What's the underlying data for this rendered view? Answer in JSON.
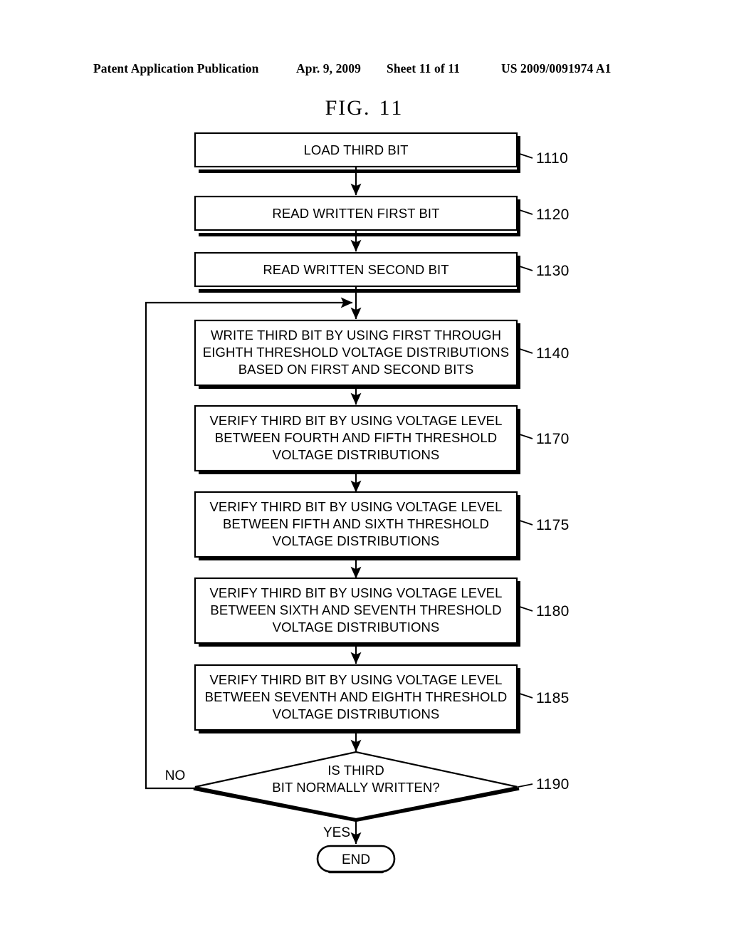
{
  "header": {
    "publication": "Patent Application Publication",
    "date": "Apr. 9, 2009",
    "sheet": "Sheet 11 of 11",
    "serial": "US 2009/0091974 A1"
  },
  "figure": {
    "label": "FIG.",
    "number": "11"
  },
  "flowchart": {
    "nodes": [
      {
        "id": "1110",
        "ref": "1110",
        "shape": "process",
        "lines": [
          "LOAD THIRD BIT"
        ]
      },
      {
        "id": "1120",
        "ref": "1120",
        "shape": "process",
        "lines": [
          "READ WRITTEN FIRST BIT"
        ]
      },
      {
        "id": "1130",
        "ref": "1130",
        "shape": "process",
        "lines": [
          "READ WRITTEN SECOND BIT"
        ]
      },
      {
        "id": "1140",
        "ref": "1140",
        "shape": "process",
        "lines": [
          "WRITE THIRD BIT BY USING FIRST THROUGH",
          "EIGHTH THRESHOLD VOLTAGE DISTRIBUTIONS",
          "BASED ON FIRST AND SECOND BITS"
        ]
      },
      {
        "id": "1170",
        "ref": "1170",
        "shape": "process",
        "lines": [
          "VERIFY THIRD BIT BY USING VOLTAGE LEVEL",
          "BETWEEN FOURTH AND FIFTH THRESHOLD",
          "VOLTAGE DISTRIBUTIONS"
        ]
      },
      {
        "id": "1175",
        "ref": "1175",
        "shape": "process",
        "lines": [
          "VERIFY THIRD BIT BY USING VOLTAGE LEVEL",
          "BETWEEN FIFTH AND SIXTH THRESHOLD",
          "VOLTAGE DISTRIBUTIONS"
        ]
      },
      {
        "id": "1180",
        "ref": "1180",
        "shape": "process",
        "lines": [
          "VERIFY THIRD BIT BY USING VOLTAGE LEVEL",
          "BETWEEN SIXTH AND SEVENTH THRESHOLD",
          "VOLTAGE DISTRIBUTIONS"
        ]
      },
      {
        "id": "1185",
        "ref": "1185",
        "shape": "process",
        "lines": [
          "VERIFY THIRD BIT BY USING VOLTAGE LEVEL",
          "BETWEEN SEVENTH AND EIGHTH THRESHOLD",
          "VOLTAGE DISTRIBUTIONS"
        ]
      },
      {
        "id": "1190",
        "ref": "1190",
        "shape": "decision",
        "lines": [
          "IS THIRD",
          "BIT NORMALLY WRITTEN?"
        ]
      },
      {
        "id": "end",
        "ref": "",
        "shape": "terminal",
        "lines": [
          "END"
        ]
      }
    ],
    "branch_labels": {
      "no": "NO",
      "yes": "YES"
    }
  }
}
